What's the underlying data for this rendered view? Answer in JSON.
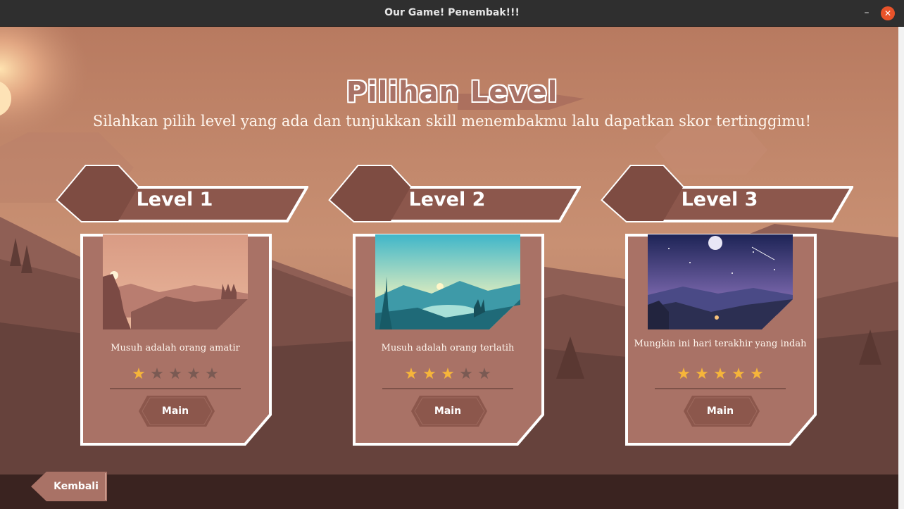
{
  "window": {
    "title": "Our Game! Penembak!!!",
    "minimize_glyph": "–",
    "close_glyph": "✕"
  },
  "header": {
    "title": "Pilihan Level",
    "subtitle": "Silahkan pilih level yang ada dan tunjukkan skill menembakmu lalu dapatkan skor tertinggimu!"
  },
  "levels": [
    {
      "title": "Level 1",
      "description": "Musuh adalah orang amatir",
      "difficulty_stars": 1,
      "max_stars": 5,
      "button_label": "Main",
      "thumbnail": "sunset-forest-illustration"
    },
    {
      "title": "Level 2",
      "description": "Musuh adalah orang terlatih",
      "difficulty_stars": 3,
      "max_stars": 5,
      "button_label": "Main",
      "thumbnail": "lake-deer-illustration"
    },
    {
      "title": "Level 3",
      "description": "Mungkin ini hari terakhir yang indah",
      "difficulty_stars": 5,
      "max_stars": 5,
      "button_label": "Main",
      "thumbnail": "night-campfire-illustration"
    }
  ],
  "footer": {
    "back_label": "Kembali"
  },
  "colors": {
    "card_fill": "#a97266",
    "card_header": "#8c574c",
    "star_on": "#f6b53a",
    "star_off": "#7a5a53",
    "close_button": "#e8532a"
  }
}
